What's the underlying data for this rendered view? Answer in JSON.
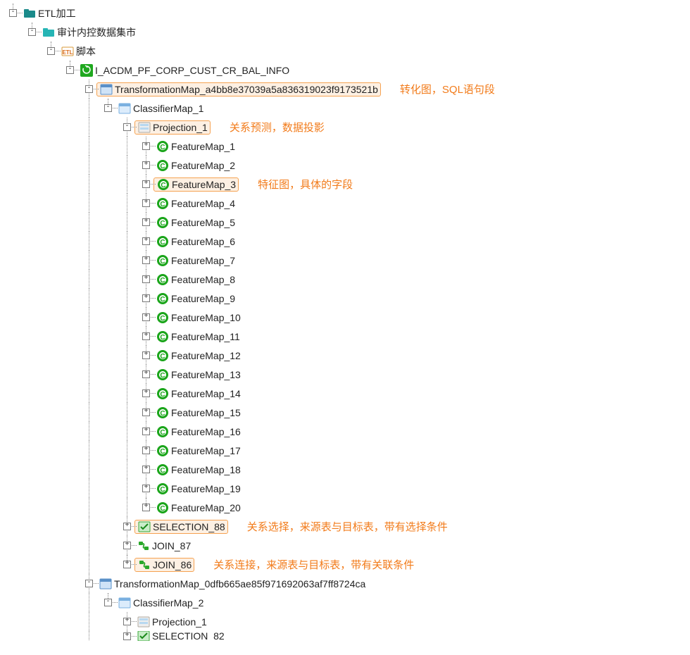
{
  "tree": {
    "n0": "ETL加工",
    "n1": "审计内控数据集市",
    "n2": "脚本",
    "n3": "I_ACDM_PF_CORP_CUST_CR_BAL_INFO",
    "n4": "TransformationMap_a4bb8e37039a5a836319023f9173521b",
    "n5": "ClassifierMap_1",
    "n6": "Projection_1",
    "f1": "FeatureMap_1",
    "f2": "FeatureMap_2",
    "f3": "FeatureMap_3",
    "f4": "FeatureMap_4",
    "f5": "FeatureMap_5",
    "f6": "FeatureMap_6",
    "f7": "FeatureMap_7",
    "f8": "FeatureMap_8",
    "f9": "FeatureMap_9",
    "f10": "FeatureMap_10",
    "f11": "FeatureMap_11",
    "f12": "FeatureMap_12",
    "f13": "FeatureMap_13",
    "f14": "FeatureMap_14",
    "f15": "FeatureMap_15",
    "f16": "FeatureMap_16",
    "f17": "FeatureMap_17",
    "f18": "FeatureMap_18",
    "f19": "FeatureMap_19",
    "f20": "FeatureMap_20",
    "sel88": "SELECTION_88",
    "join87": "JOIN_87",
    "join86": "JOIN_86",
    "n7": "TransformationMap_0dfb665ae85f971692063af7ff8724ca",
    "n8": "ClassifierMap_2",
    "n9": "Projection_1",
    "sel82": "SELECTION_82"
  },
  "notes": {
    "tm": "转化图，SQL语句段",
    "proj": "关系预测，数据投影",
    "fm": "特征图，具体的字段",
    "sel": "关系选择，来源表与目标表，带有选择条件",
    "join": "关系连接，来源表与目标表，带有关联条件"
  }
}
